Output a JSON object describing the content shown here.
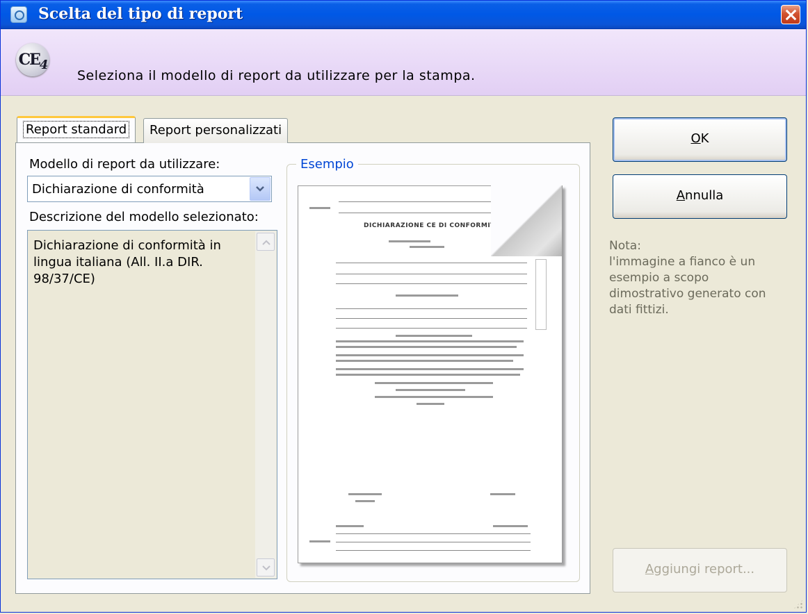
{
  "window": {
    "title": "Scelta del tipo di report"
  },
  "header": {
    "logo_text": "CE",
    "logo_sub": "4",
    "instruction": "Seleziona il modello di report da utilizzare per la stampa."
  },
  "tabs": [
    {
      "label": "Report standard",
      "active": true
    },
    {
      "label": "Report personalizzati",
      "active": false
    }
  ],
  "form": {
    "model_label": "Modello di report da utilizzare:",
    "selected_model": "Dichiarazione di conformità",
    "description_label": "Descrizione del modello selezionato:",
    "description_text": "Dichiarazione di conformità in lingua italiana (All. II.a DIR. 98/37/CE)"
  },
  "preview": {
    "group_title": "Esempio",
    "doc_title": "DICHIARAZIONE CE DI CONFORMITA'"
  },
  "buttons": {
    "ok": {
      "mnemonic": "O",
      "rest": "K"
    },
    "cancel": {
      "mnemonic": "A",
      "rest": "nnulla"
    },
    "add_report": {
      "mnemonic": "A",
      "rest": "ggiungi report..."
    }
  },
  "note": "Nota:\nl'immagine a fianco è un esempio a scopo dimostrativo generato con dati fittizi.",
  "colors": {
    "titlebar": "#0058e6",
    "header_band": "#e8d9f7",
    "group_title": "#0046d5",
    "note_text": "#6b6a5b"
  }
}
